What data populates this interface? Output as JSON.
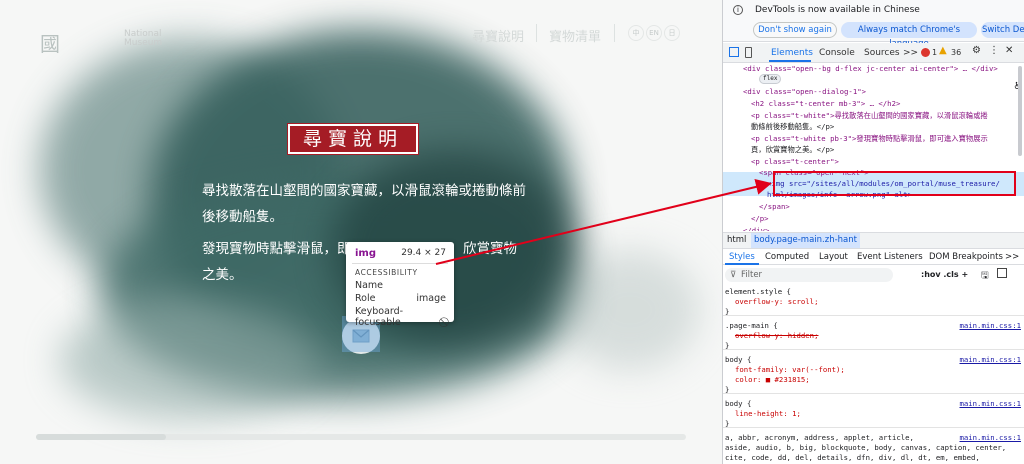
{
  "site": {
    "logo_mark": "國",
    "logo_sub_1": "National",
    "logo_sub_2": "Museum",
    "nav": [
      "尋寶說明",
      "寶物清單"
    ],
    "lang": [
      "中",
      "EN",
      "日"
    ],
    "title": "尋寶說明",
    "para1_line1": "尋找散落在山壑間的國家寶藏，以滑鼠滾輪或捲動條前",
    "para1_line2": "後移動船隻。",
    "para2_line1a": "發現寶物時點擊滑鼠，即",
    "para2_line1b": "，欣賞寶物",
    "para2_line2": "之美。"
  },
  "tooltip": {
    "tag": "img",
    "dims": "29.4 × 27",
    "heading": "ACCESSIBILITY",
    "rows": [
      {
        "label": "Name",
        "value": ""
      },
      {
        "label": "Role",
        "value": "image"
      },
      {
        "label": "Keyboard-focusable",
        "value": "⃠"
      }
    ]
  },
  "devtools": {
    "notice": "DevTools is now available in Chinese",
    "btn_dont_show": "Don't show again",
    "btn_match": "Always match Chrome's language",
    "btn_switch": "Switch DevTools to Chinese",
    "tabs": [
      "Elements",
      "Console",
      "Sources",
      ">>"
    ],
    "errors": "1",
    "warnings": "36",
    "dom_lines": [
      {
        "indent": 2,
        "html": "<div class=\"open--bg d-flex jc-center ai-center\"> … </div>"
      },
      {
        "indent": 4,
        "html": "flex"
      },
      {
        "indent": 2,
        "html": "<div class=\"open--dialog-1\">"
      },
      {
        "indent": 3,
        "html": "<h2 class=\"t-center mb-3\"> … </h2>"
      },
      {
        "indent": 3,
        "html": "<p class=\"t-white\">尋找散落在山壑間的國家寶藏，以滑鼠滾輪或捲"
      },
      {
        "indent": 3,
        "html": "動條前後移動船隻。</p>"
      },
      {
        "indent": 3,
        "html": "<p class=\"t-white pb-3\">發現寶物時點擊滑鼠，即可進入寶物展示"
      },
      {
        "indent": 3,
        "html": "頁，欣賞寶物之美。</p>"
      },
      {
        "indent": 3,
        "html": "<p class=\"t-center\">"
      },
      {
        "indent": 4,
        "html": "<span class=\"open--next\">"
      },
      {
        "indent": 5,
        "html": "<img src=\"/sites/all/modules/om_portal/muse_treasure/"
      },
      {
        "indent": 5,
        "html": "html/images/info--arrow.png\" alt>"
      },
      {
        "indent": 4,
        "html": "</span>"
      },
      {
        "indent": 3,
        "html": "</p>"
      },
      {
        "indent": 2,
        "html": "</div>"
      }
    ],
    "crumbs": [
      "html",
      "body.page-main.zh-hant"
    ],
    "style_tabs": [
      "Styles",
      "Computed",
      "Layout",
      "Event Listeners",
      "DOM Breakpoints",
      ">>"
    ],
    "filter_placeholder": "Filter",
    "filter_tools": ":hov .cls + ",
    "rules": [
      {
        "selector": "element.style {",
        "props": [
          "overflow-y: scroll;"
        ],
        "source": ""
      },
      {
        "selector": ".page-main {",
        "props": [
          "overflow-y: hidden;"
        ],
        "source": "main.min.css:1",
        "struck": true
      },
      {
        "selector": "body {",
        "props": [
          "font-family: var(--font);",
          "color: ■ #231815;"
        ],
        "source": "main.min.css:1"
      },
      {
        "selector": "body {",
        "props": [
          "line-height: 1;"
        ],
        "source": "main.min.css:1"
      },
      {
        "selector": "a, abbr, acronym, address, applet, article,",
        "props": [],
        "source": "main.min.css:1"
      },
      {
        "selector": "aside, audio, b, big, blockquote, body, canvas, caption, center,",
        "props": [],
        "source": ""
      },
      {
        "selector": "cite, code, dd, del, details, dfn, div, dl, dt, em, embed,",
        "props": [],
        "source": ""
      }
    ]
  },
  "colors": {
    "accent_red": "#a51c25",
    "devtools_blue": "#1a73e8",
    "annotation_red": "#e1001a"
  }
}
